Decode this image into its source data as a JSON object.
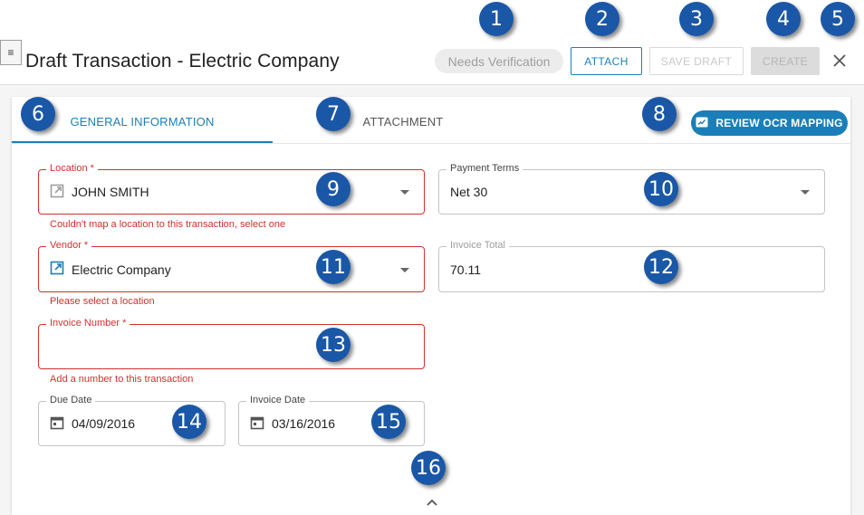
{
  "header": {
    "menu_icon": "≡",
    "title": "Draft Transaction - Electric Company",
    "status_chip": "Needs Verification",
    "attach_label": "ATTACH",
    "save_draft_label": "SAVE DRAFT",
    "create_label": "CREATE",
    "close_icon": "close-icon"
  },
  "tabs": [
    {
      "label": "GENERAL INFORMATION",
      "active": true
    },
    {
      "label": "ATTACHMENT",
      "active": false
    }
  ],
  "review_ocr_label": "REVIEW OCR MAPPING",
  "form": {
    "location": {
      "label": "Location *",
      "value": "JOHN SMITH",
      "error": "Couldn't map a location to this transaction, select one"
    },
    "payment_terms": {
      "label": "Payment Terms",
      "value": "Net 30"
    },
    "vendor": {
      "label": "Vendor *",
      "value": "Electric Company",
      "error": "Please select a location"
    },
    "invoice_total": {
      "label": "Invoice Total",
      "value": "70.11"
    },
    "invoice_number": {
      "label": "Invoice Number *",
      "value": "",
      "error": "Add a number to this transaction"
    },
    "due_date": {
      "label": "Due Date",
      "value": "04/09/2016"
    },
    "invoice_date": {
      "label": "Invoice Date",
      "value": "03/16/2016"
    }
  },
  "callouts": [
    "1",
    "2",
    "3",
    "4",
    "5",
    "6",
    "7",
    "8",
    "9",
    "10",
    "11",
    "12",
    "13",
    "14",
    "15",
    "16"
  ],
  "colors": {
    "accent": "#1a7fb8",
    "error": "#d32f2f",
    "callout": "#1a57a7"
  }
}
